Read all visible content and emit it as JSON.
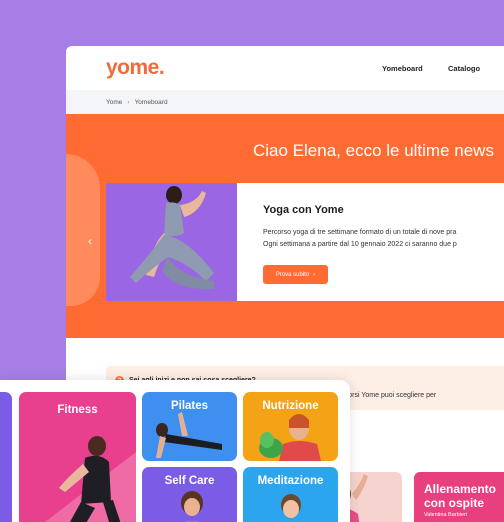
{
  "header": {
    "logo": "yome.",
    "nav": [
      "Yomeboard",
      "Catalogo"
    ]
  },
  "breadcrumb": [
    "Yome",
    "Yomeboard"
  ],
  "hero": {
    "title": "Ciao Elena, ecco le ultime news",
    "card": {
      "title": "Yoga con Yome",
      "desc_line1": "Percorso yoga di tre settimane formato di un totale di nove pra",
      "desc_line2": "Ogni settimana a partire dal 10 gennaio 2022 ci saranno due p",
      "button": "Prova subito"
    }
  },
  "info": {
    "question": "Sei agli inizi e non sai cosa scegliere?",
    "detail": "rire quali corsi Yome puoi scegliere per"
  },
  "bottom_cards": [
    {
      "title": "Allenamento",
      "title2": "con ospite",
      "subtitle": "Valentina Barbieri"
    }
  ],
  "categories": [
    {
      "label": "Fitness",
      "color": "#e83f8e"
    },
    {
      "label": "Pilates",
      "color": "#3f8ff0"
    },
    {
      "label": "Nutrizione",
      "color": "#f5a316"
    },
    {
      "label": "Self Care",
      "color": "#7b5ce6"
    },
    {
      "label": "Meditazione",
      "color": "#2ca5ef"
    }
  ],
  "colors": {
    "accent": "#ff6b33",
    "background": "#a67ee6"
  }
}
